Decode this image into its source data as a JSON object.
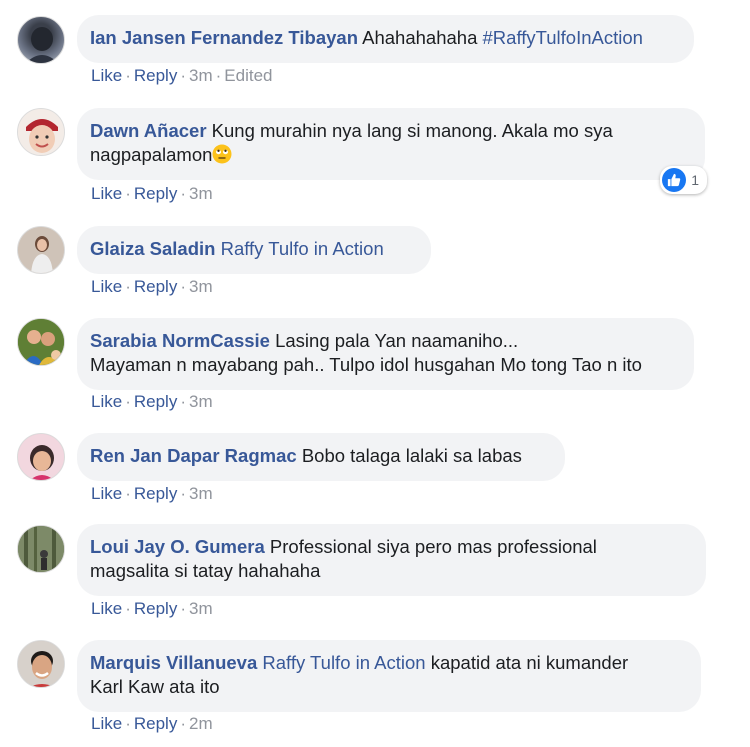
{
  "comments": [
    {
      "author": "Ian Jansen Fernandez Tibayan",
      "text_parts": [
        {
          "type": "text",
          "value": "Ahahahahaha "
        },
        {
          "type": "hashtag",
          "value": "#RaffyTulfoInAction"
        }
      ],
      "actions": {
        "like": "Like",
        "reply": "Reply",
        "time": "3m",
        "edited": "Edited"
      }
    },
    {
      "author": "Dawn Añacer",
      "text_line1": "Kung murahin nya lang si manong. Akala mo sya",
      "text_line2": "nagpapalamon",
      "emoji": "rolling-eyes-emoji",
      "reaction": {
        "icon": "thumbs-up-icon",
        "count": "1"
      },
      "actions": {
        "like": "Like",
        "reply": "Reply",
        "time": "3m"
      }
    },
    {
      "author": "Glaiza Saladin",
      "mention": "Raffy Tulfo in Action",
      "actions": {
        "like": "Like",
        "reply": "Reply",
        "time": "3m"
      }
    },
    {
      "author": "Sarabia NormCassie",
      "text_line1": "Lasing pala Yan naamaniho...",
      "text_line2": "Mayaman n mayabang pah.. Tulpo idol husgahan Mo tong Tao n ito",
      "actions": {
        "like": "Like",
        "reply": "Reply",
        "time": "3m"
      }
    },
    {
      "author": "Ren Jan Dapar Ragmac",
      "text": "Bobo talaga lalaki sa labas",
      "actions": {
        "like": "Like",
        "reply": "Reply",
        "time": "3m"
      }
    },
    {
      "author": "Loui Jay O. Gumera",
      "text_line1": "Professional siya pero mas professional",
      "text_line2": "magsalita si tatay hahahaha",
      "actions": {
        "like": "Like",
        "reply": "Reply",
        "time": "3m"
      }
    },
    {
      "author": "Marquis Villanueva",
      "mention": "Raffy Tulfo in Action",
      "text_line1": "kapatid ata ni kumander",
      "text_line2": "Karl Kaw ata ito",
      "actions": {
        "like": "Like",
        "reply": "Reply",
        "time": "2m"
      }
    }
  ],
  "separator": "·",
  "colors": {
    "link": "#385898",
    "muted": "#90949c",
    "bubble": "#f2f3f5",
    "like_blue": "#1877f2"
  }
}
